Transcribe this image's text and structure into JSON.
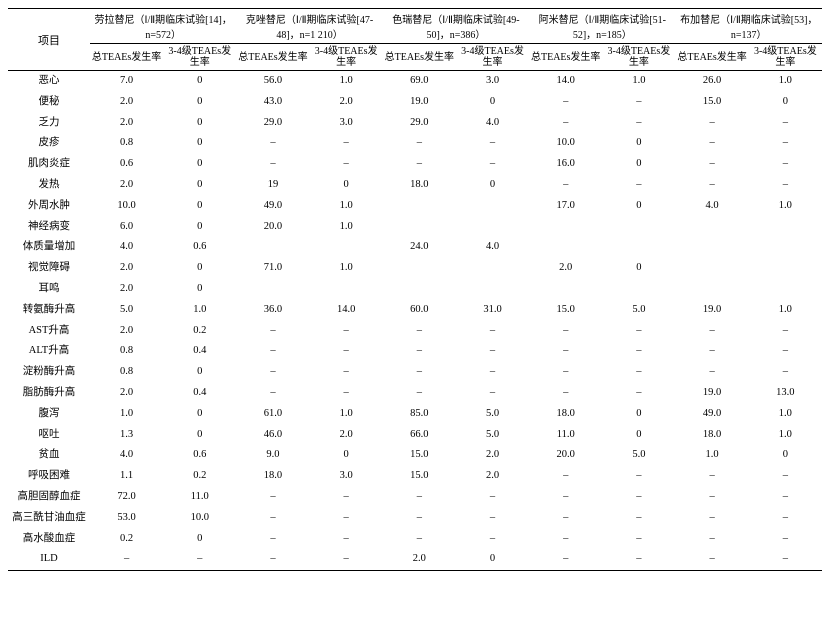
{
  "header": {
    "item_label": "项目",
    "drugs": [
      {
        "name": "劳拉替尼（Ⅰ/Ⅱ期临床试验[14]，n=572）"
      },
      {
        "name": "克唑替尼（Ⅰ/Ⅱ期临床试验[47-48]，n=1 210）"
      },
      {
        "name": "色瑞替尼（Ⅰ/Ⅱ期临床试验[49-50]，n=386）"
      },
      {
        "name": "阿米替尼（Ⅰ/Ⅱ期临床试验[51-52]，n=185）"
      },
      {
        "name": "布加替尼（Ⅰ/Ⅱ期临床试验[53]，n=137）"
      }
    ],
    "sub_total": "总TEAEs发生率",
    "sub_g34": "3-4级TEAEs发生率"
  },
  "rows": [
    {
      "label": "恶心",
      "v": [
        "7.0",
        "0",
        "56.0",
        "1.0",
        "69.0",
        "3.0",
        "14.0",
        "1.0",
        "26.0",
        "1.0"
      ]
    },
    {
      "label": "便秘",
      "v": [
        "2.0",
        "0",
        "43.0",
        "2.0",
        "19.0",
        "0",
        "–",
        "–",
        "15.0",
        "0"
      ]
    },
    {
      "label": "乏力",
      "v": [
        "2.0",
        "0",
        "29.0",
        "3.0",
        "29.0",
        "4.0",
        "–",
        "–",
        "–",
        "–"
      ]
    },
    {
      "label": "皮疹",
      "v": [
        "0.8",
        "0",
        "–",
        "–",
        "–",
        "–",
        "10.0",
        "0",
        "–",
        "–"
      ]
    },
    {
      "label": "肌肉炎症",
      "v": [
        "0.6",
        "0",
        "–",
        "–",
        "–",
        "–",
        "16.0",
        "0",
        "–",
        "–"
      ]
    },
    {
      "label": "发热",
      "v": [
        "2.0",
        "0",
        "19",
        "0",
        "18.0",
        "0",
        "–",
        "–",
        "–",
        "–"
      ]
    },
    {
      "label": "外周水肿",
      "v": [
        "10.0",
        "0",
        "49.0",
        "1.0",
        "",
        "",
        "17.0",
        "0",
        "4.0",
        "1.0"
      ]
    },
    {
      "label": "神经病变",
      "v": [
        "6.0",
        "0",
        "20.0",
        "1.0",
        "",
        "",
        "",
        "",
        "",
        ""
      ]
    },
    {
      "label": "体质量增加",
      "v": [
        "4.0",
        "0.6",
        "",
        "",
        "24.0",
        "4.0",
        "",
        "",
        "",
        ""
      ]
    },
    {
      "label": "视觉障碍",
      "v": [
        "2.0",
        "0",
        "71.0",
        "1.0",
        "",
        "",
        "2.0",
        "0",
        "",
        ""
      ]
    },
    {
      "label": "耳鸣",
      "v": [
        "2.0",
        "0",
        "",
        "",
        "",
        "",
        "",
        "",
        "",
        ""
      ]
    },
    {
      "label": "转氨酶升高",
      "v": [
        "5.0",
        "1.0",
        "36.0",
        "14.0",
        "60.0",
        "31.0",
        "15.0",
        "5.0",
        "19.0",
        "1.0"
      ]
    },
    {
      "label": "AST升高",
      "v": [
        "2.0",
        "0.2",
        "–",
        "–",
        "–",
        "–",
        "–",
        "–",
        "–",
        "–"
      ]
    },
    {
      "label": "ALT升高",
      "v": [
        "0.8",
        "0.4",
        "–",
        "–",
        "–",
        "–",
        "–",
        "–",
        "–",
        "–"
      ]
    },
    {
      "label": "淀粉酶升高",
      "v": [
        "0.8",
        "0",
        "–",
        "–",
        "–",
        "–",
        "–",
        "–",
        "–",
        "–"
      ]
    },
    {
      "label": "脂肪酶升高",
      "v": [
        "2.0",
        "0.4",
        "–",
        "–",
        "–",
        "–",
        "–",
        "–",
        "19.0",
        "13.0"
      ]
    },
    {
      "label": "腹泻",
      "v": [
        "1.0",
        "0",
        "61.0",
        "1.0",
        "85.0",
        "5.0",
        "18.0",
        "0",
        "49.0",
        "1.0"
      ]
    },
    {
      "label": "呕吐",
      "v": [
        "1.3",
        "0",
        "46.0",
        "2.0",
        "66.0",
        "5.0",
        "11.0",
        "0",
        "18.0",
        "1.0"
      ]
    },
    {
      "label": "贫血",
      "v": [
        "4.0",
        "0.6",
        "9.0",
        "0",
        "15.0",
        "2.0",
        "20.0",
        "5.0",
        "1.0",
        "0"
      ]
    },
    {
      "label": "呼吸困难",
      "v": [
        "1.1",
        "0.2",
        "18.0",
        "3.0",
        "15.0",
        "2.0",
        "–",
        "–",
        "–",
        "–"
      ]
    },
    {
      "label": "高胆固醇血症",
      "v": [
        "72.0",
        "11.0",
        "–",
        "–",
        "–",
        "–",
        "–",
        "–",
        "–",
        "–"
      ]
    },
    {
      "label": "高三酰甘油血症",
      "v": [
        "53.0",
        "10.0",
        "–",
        "–",
        "–",
        "–",
        "–",
        "–",
        "–",
        "–"
      ]
    },
    {
      "label": "高水酸血症",
      "v": [
        "0.2",
        "0",
        "–",
        "–",
        "–",
        "–",
        "–",
        "–",
        "–",
        "–"
      ]
    },
    {
      "label": "ILD",
      "v": [
        "–",
        "–",
        "–",
        "–",
        "2.0",
        "0",
        "–",
        "–",
        "–",
        "–"
      ]
    }
  ]
}
